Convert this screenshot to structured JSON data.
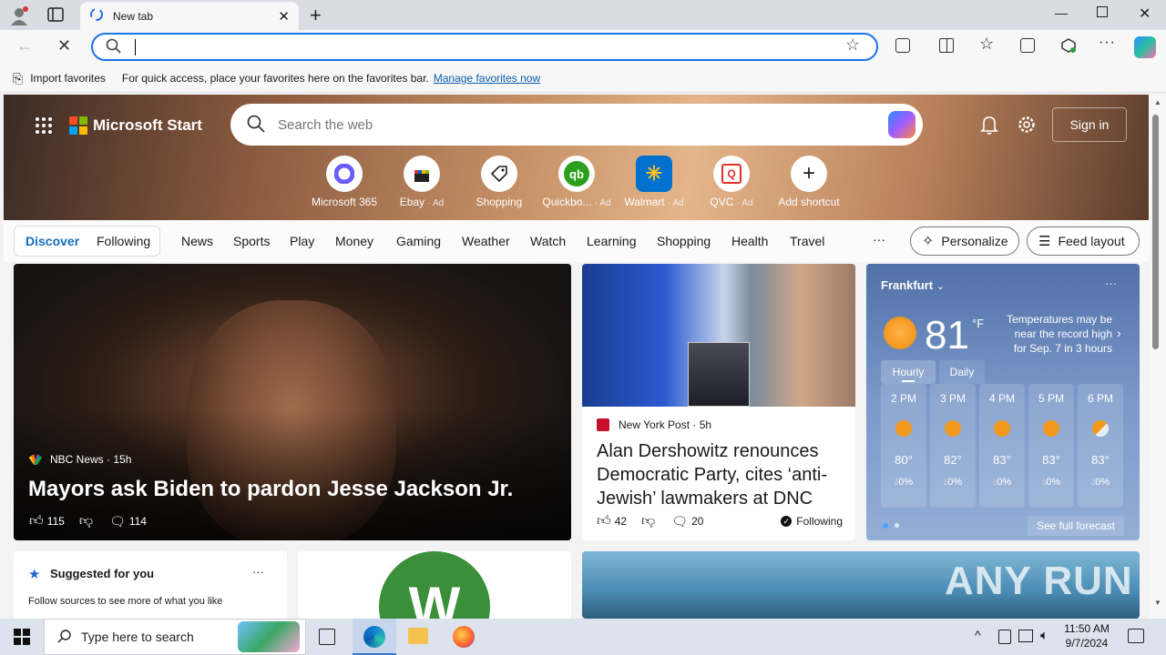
{
  "browser": {
    "tab_title": "New tab",
    "address_value": "",
    "favbar": {
      "import_label": "Import favorites",
      "message": "For quick access, place your favorites here on the favorites bar.",
      "manage_link": "Manage favorites now"
    }
  },
  "start": {
    "brand": "Microsoft Start",
    "search_placeholder": "Search the web",
    "signin_label": "Sign in",
    "shortcuts": [
      {
        "label": "Microsoft 365",
        "ad": ""
      },
      {
        "label": "Ebay",
        "ad": "· Ad"
      },
      {
        "label": "Shopping",
        "ad": ""
      },
      {
        "label": "Quickbo...",
        "ad": "· Ad"
      },
      {
        "label": "Walmart",
        "ad": "· Ad"
      },
      {
        "label": "QVC",
        "ad": "· Ad"
      },
      {
        "label": "Add shortcut",
        "ad": ""
      }
    ],
    "feed_tabs": {
      "discover": "Discover",
      "following": "Following"
    },
    "nav_items": [
      "News",
      "Sports",
      "Play",
      "Money",
      "Gaming",
      "Weather",
      "Watch",
      "Learning",
      "Shopping",
      "Health",
      "Travel"
    ],
    "more_label": "···",
    "personalize_label": "Personalize",
    "feed_layout_label": "Feed layout"
  },
  "lead_story": {
    "source": "NBC News",
    "age": "· 15h",
    "headline": "Mayors ask Biden to pardon Jesse Jackson Jr.",
    "likes": "115",
    "comments": "114"
  },
  "mid_story": {
    "source": "New York Post",
    "age": "· 5h",
    "headline": "Alan Dershowitz renounces Democratic Party, cites ‘anti-Jewish’ lawmakers at DNC",
    "likes": "42",
    "comments": "20",
    "following_label": "Following"
  },
  "weather": {
    "city": "Frankfurt",
    "temp": "81",
    "unit": "°F",
    "alert": "Temperatures may be near the record high for Sep. 7 in 3 hours",
    "tab_hourly": "Hourly",
    "tab_daily": "Daily",
    "hours": [
      {
        "time": "2 PM",
        "temp": "80°",
        "precip": "0%"
      },
      {
        "time": "3 PM",
        "temp": "82°",
        "precip": "0%"
      },
      {
        "time": "4 PM",
        "temp": "83°",
        "precip": "0%"
      },
      {
        "time": "5 PM",
        "temp": "83°",
        "precip": "0%"
      },
      {
        "time": "6 PM",
        "temp": "83°",
        "precip": "0%"
      }
    ],
    "forecast_link": "See full forecast"
  },
  "suggested": {
    "title": "Suggested for you",
    "subtitle": "Follow sources to see more of what you like"
  },
  "taskbar": {
    "search_placeholder": "Type here to search",
    "time": "11:50 AM",
    "date": "9/7/2024"
  },
  "watermark": "ANY RUN"
}
